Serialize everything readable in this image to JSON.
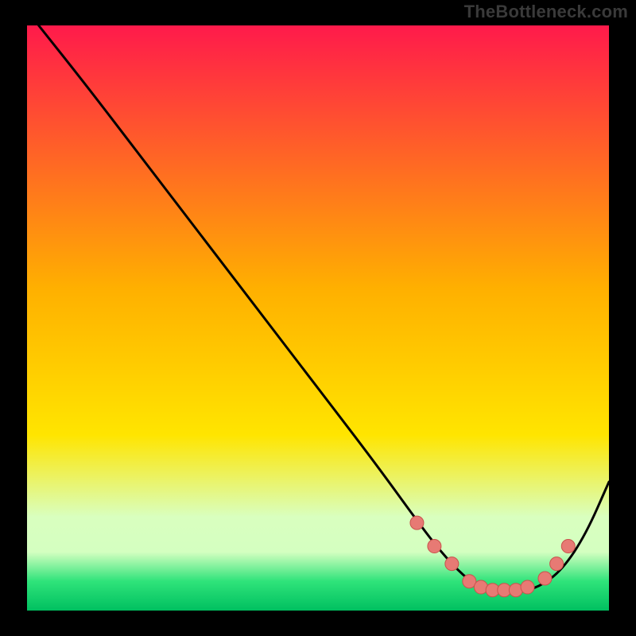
{
  "watermark": "TheBottleneck.com",
  "colors": {
    "gradient_top": "#ff1a4b",
    "gradient_mid": "#ffd400",
    "gradient_green_light": "#d9ffbf",
    "gradient_green": "#2fe37a",
    "gradient_bottom": "#00c060",
    "curve": "#000000",
    "marker_fill": "#e77a74",
    "marker_stroke": "#c9534c",
    "plot_bg_border": "#000000"
  },
  "chart_data": {
    "type": "line",
    "title": "",
    "xlabel": "",
    "ylabel": "",
    "xlim": [
      0,
      100
    ],
    "ylim": [
      0,
      100
    ],
    "series": [
      {
        "name": "bottleneck-curve",
        "x": [
          2,
          10,
          20,
          30,
          40,
          50,
          60,
          68,
          72,
          76,
          80,
          84,
          88,
          92,
          96,
          100
        ],
        "y": [
          100,
          90,
          77,
          64,
          51,
          38,
          25,
          14,
          9,
          5,
          3,
          3,
          4,
          7,
          13,
          22
        ]
      }
    ],
    "markers": {
      "name": "highlight-points",
      "x": [
        67,
        70,
        73,
        76,
        78,
        80,
        82,
        84,
        86,
        89,
        91,
        93
      ],
      "y": [
        15,
        11,
        8,
        5,
        4,
        3.5,
        3.5,
        3.5,
        4,
        5.5,
        8,
        11
      ]
    }
  }
}
